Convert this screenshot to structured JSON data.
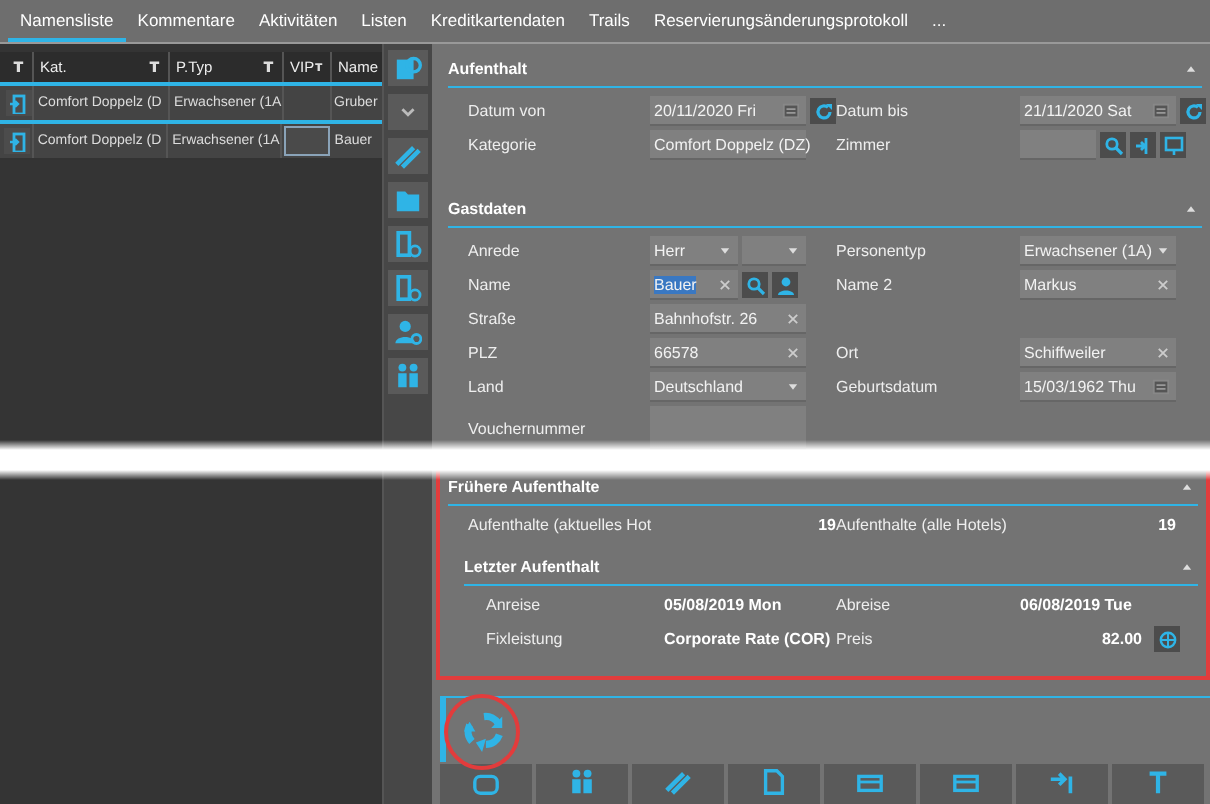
{
  "tabs": [
    {
      "label": "Namensliste",
      "selected": true
    },
    {
      "label": "Kommentare",
      "selected": false
    },
    {
      "label": "Aktivitäten",
      "selected": false
    },
    {
      "label": "Listen",
      "selected": false
    },
    {
      "label": "Kreditkartendaten",
      "selected": false
    },
    {
      "label": "Trails",
      "selected": false
    },
    {
      "label": "Reservierungsänderungsprotokoll",
      "selected": false
    },
    {
      "label": "...",
      "selected": false
    }
  ],
  "table": {
    "columns": [
      {
        "label": "Kat."
      },
      {
        "label": "P.Typ"
      },
      {
        "label": "VIP"
      },
      {
        "label": "Name"
      }
    ],
    "rows": [
      {
        "cells": [
          "Comfort Doppelz (D",
          "Erwachsener (1A",
          null,
          "Gruber"
        ],
        "vip_focused": false
      },
      {
        "cells": [
          "Comfort Doppelz (D",
          "Erwachsener (1A",
          null,
          "Bauer"
        ],
        "vip_focused": true
      }
    ]
  },
  "aufenthalt": {
    "title": "Aufenthalt",
    "rows": [
      [
        {
          "label": "Datum von",
          "value": "20/11/2020 Fri",
          "kind": "date"
        },
        {
          "label": "Datum bis",
          "value": "21/11/2020 Sat",
          "kind": "date"
        }
      ],
      [
        {
          "label": "Kategorie",
          "value": "Comfort Doppelz (DZ)",
          "kind": "select"
        },
        {
          "label": "Zimmer",
          "kind": "room"
        }
      ]
    ]
  },
  "gastdaten": {
    "title": "Gastdaten",
    "rows": [
      [
        {
          "label": "Anrede",
          "value": "Herr",
          "kind": "salutation"
        },
        {
          "label": "Personentyp",
          "value": "Erwachsener (1A)",
          "kind": "select"
        }
      ],
      [
        {
          "label": "Name",
          "value": "Bauer",
          "kind": "name",
          "text_selected": true
        },
        {
          "label": "Name 2",
          "value": "Markus",
          "kind": "text"
        }
      ],
      [
        {
          "label": "Straße",
          "value": "Bahnhofstr. 26",
          "kind": "text"
        }
      ],
      [
        {
          "label": "PLZ",
          "value": "66578",
          "kind": "text"
        },
        {
          "label": "Ort",
          "value": "Schiffweiler",
          "kind": "text"
        }
      ],
      [
        {
          "label": "Land",
          "value": "Deutschland",
          "kind": "select"
        },
        {
          "label": "Geburtsdatum",
          "value": "15/03/1962 Thu",
          "kind": "birthdate"
        }
      ],
      [
        {
          "label": "Vouchernummer",
          "kind": "multiline"
        }
      ]
    ]
  },
  "fruehere_aufenthalte": {
    "title": "Frühere Aufenthalte",
    "counts": [
      {
        "label": "Aufenthalte (aktuelles Hot",
        "value": "19"
      },
      {
        "label": "Aufenthalte (alle Hotels)",
        "value": "19"
      }
    ],
    "letzter_aufenthalt": {
      "title": "Letzter Aufenthalt",
      "rows": [
        [
          {
            "label": "Anreise",
            "value": "05/08/2019 Mon"
          },
          {
            "label": "Abreise",
            "value": "06/08/2019 Tue"
          }
        ],
        [
          {
            "label": "Fixleistung",
            "value": "Corporate Rate (COR)"
          },
          {
            "label": "Preis",
            "value": "82.00",
            "kind": "price"
          }
        ]
      ]
    }
  }
}
